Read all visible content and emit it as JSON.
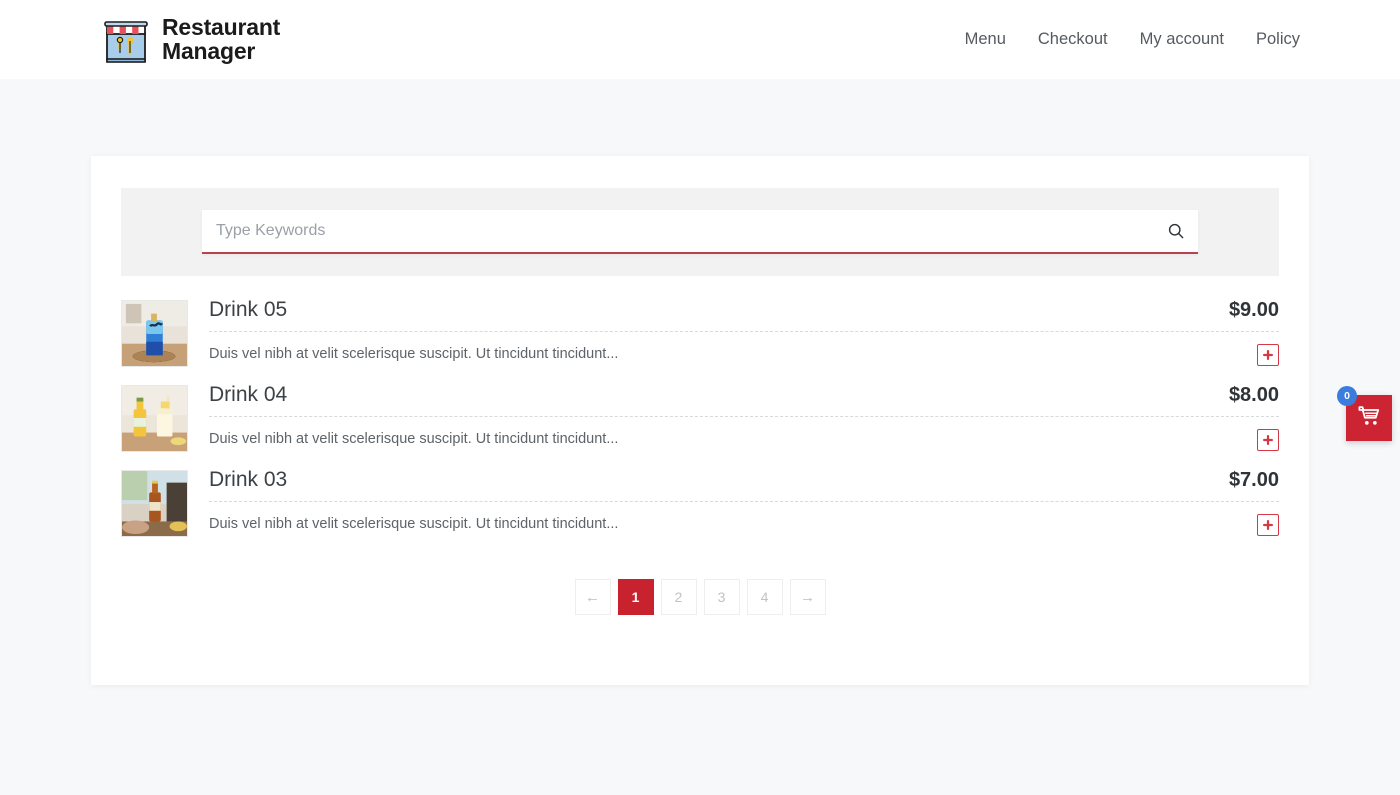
{
  "brand": {
    "name": "Restaurant\nManager",
    "logo_icon": "storefront-icon"
  },
  "nav": {
    "items": [
      {
        "label": "Menu"
      },
      {
        "label": "Checkout"
      },
      {
        "label": "My account"
      },
      {
        "label": "Policy"
      }
    ]
  },
  "search": {
    "placeholder": "Type Keywords",
    "value": "",
    "icon": "search-icon"
  },
  "products": [
    {
      "title": "Drink 05",
      "price": "$9.00",
      "description": "Duis vel nibh at velit scelerisque suscipit. Ut tincidunt tincidunt...",
      "image_alt": "blue-layered-cocktail",
      "add_label": "+"
    },
    {
      "title": "Drink 04",
      "price": "$8.00",
      "description": "Duis vel nibh at velit scelerisque suscipit. Ut tincidunt tincidunt...",
      "image_alt": "yellow-bottle-and-glass",
      "add_label": "+"
    },
    {
      "title": "Drink 03",
      "price": "$7.00",
      "description": "Duis vel nibh at velit scelerisque suscipit. Ut tincidunt tincidunt...",
      "image_alt": "amber-bottle-outdoors",
      "add_label": "+"
    }
  ],
  "pagination": {
    "prev_label": "←",
    "next_label": "→",
    "pages": [
      "1",
      "2",
      "3",
      "4"
    ],
    "active_page": "1"
  },
  "cart": {
    "count": "0",
    "icon": "shopping-cart-icon"
  },
  "colors": {
    "accent_red": "#c9222f",
    "badge_blue": "#3b7ddd",
    "page_bg": "#f7f8fa",
    "search_panel_bg": "#f2f2f2"
  }
}
